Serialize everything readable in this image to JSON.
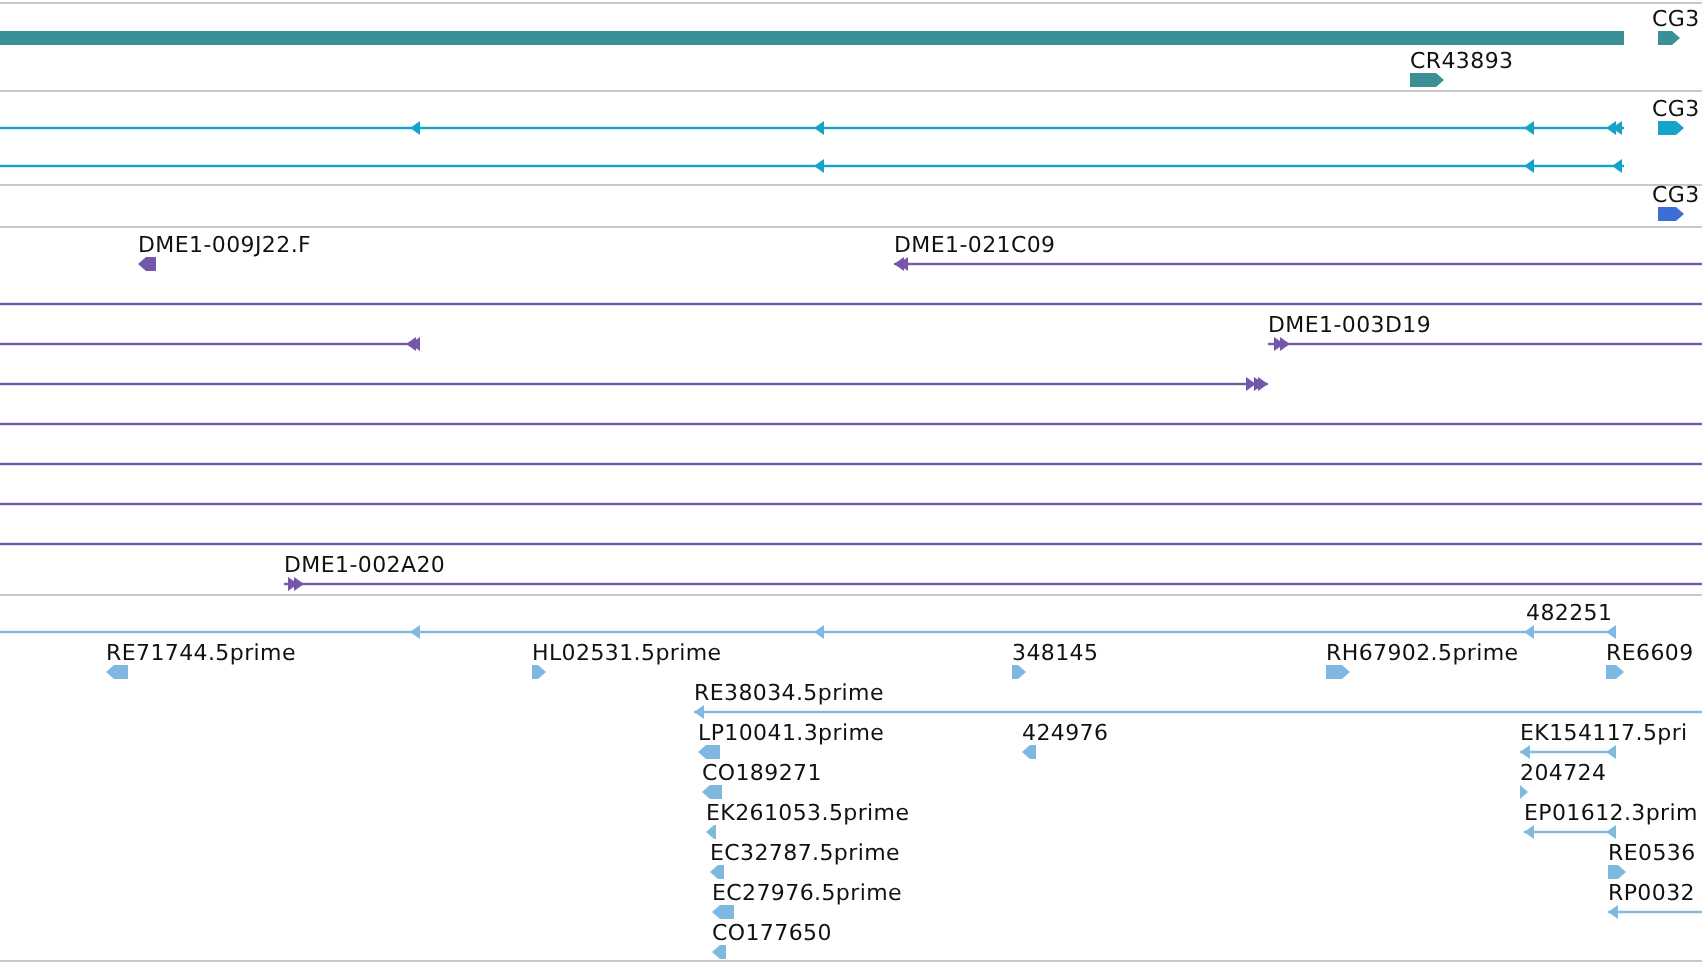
{
  "tracks": [
    {
      "color": "#3a9097",
      "features": [
        {
          "kind": "bar"
        },
        {
          "kind": "block",
          "label": "CG3",
          "reverse": false
        },
        {
          "kind": "block",
          "label": "CR43893",
          "reverse": false
        }
      ]
    },
    {
      "color": "#15a3c9",
      "features": [
        {
          "kind": "transcript",
          "reverse": true
        },
        {
          "kind": "block",
          "label": "CG3",
          "reverse": false
        },
        {
          "kind": "transcript",
          "reverse": true
        }
      ]
    },
    {
      "color": "#3b6fd6",
      "features": [
        {
          "kind": "block",
          "label": "CG3",
          "reverse": false
        }
      ]
    },
    {
      "color": "#7357aa",
      "features": [
        {
          "kind": "block",
          "label": "DME1-009J22.F",
          "reverse": true
        },
        {
          "kind": "transcript",
          "label": "DME1-021C09",
          "reverse": true
        },
        {
          "kind": "transcript"
        },
        {
          "kind": "transcript",
          "reverse": true
        },
        {
          "kind": "transcript",
          "label": "DME1-003D19",
          "reverse": false
        },
        {
          "kind": "transcript",
          "reverse": false
        },
        {
          "kind": "transcript"
        },
        {
          "kind": "transcript"
        },
        {
          "kind": "transcript"
        },
        {
          "kind": "transcript"
        },
        {
          "kind": "transcript",
          "label": "DME1-002A20",
          "reverse": false
        }
      ]
    },
    {
      "color": "#80b9e0",
      "features": [
        {
          "kind": "transcript",
          "label": "482251",
          "reverse": true
        },
        {
          "kind": "block",
          "label": "RE71744.5prime",
          "reverse": true
        },
        {
          "kind": "block",
          "label": "HL02531.5prime",
          "reverse": false
        },
        {
          "kind": "block",
          "label": "348145",
          "reverse": false
        },
        {
          "kind": "block",
          "label": "RH67902.5prime",
          "reverse": false
        },
        {
          "kind": "block",
          "label": "RE6609",
          "reverse": false
        },
        {
          "kind": "transcript",
          "label": "RE38034.5prime",
          "reverse": true
        },
        {
          "kind": "block",
          "label": "LP10041.3prime",
          "reverse": true
        },
        {
          "kind": "block",
          "label": "424976",
          "reverse": true
        },
        {
          "kind": "transcript",
          "label": "EK154117.5pri",
          "reverse": true
        },
        {
          "kind": "block",
          "label": "CO189271",
          "reverse": true
        },
        {
          "kind": "block",
          "label": "204724",
          "reverse": false
        },
        {
          "kind": "block",
          "label": "EK261053.5prime",
          "reverse": true
        },
        {
          "kind": "transcript",
          "label": "EP01612.3prim",
          "reverse": true
        },
        {
          "kind": "block",
          "label": "EC32787.5prime",
          "reverse": true
        },
        {
          "kind": "block",
          "label": "RE0536",
          "reverse": false
        },
        {
          "kind": "block",
          "label": "EC27976.5prime",
          "reverse": true
        },
        {
          "kind": "transcript",
          "label": "RP0032",
          "reverse": true
        },
        {
          "kind": "block",
          "label": "CO177650",
          "reverse": true
        }
      ]
    }
  ]
}
